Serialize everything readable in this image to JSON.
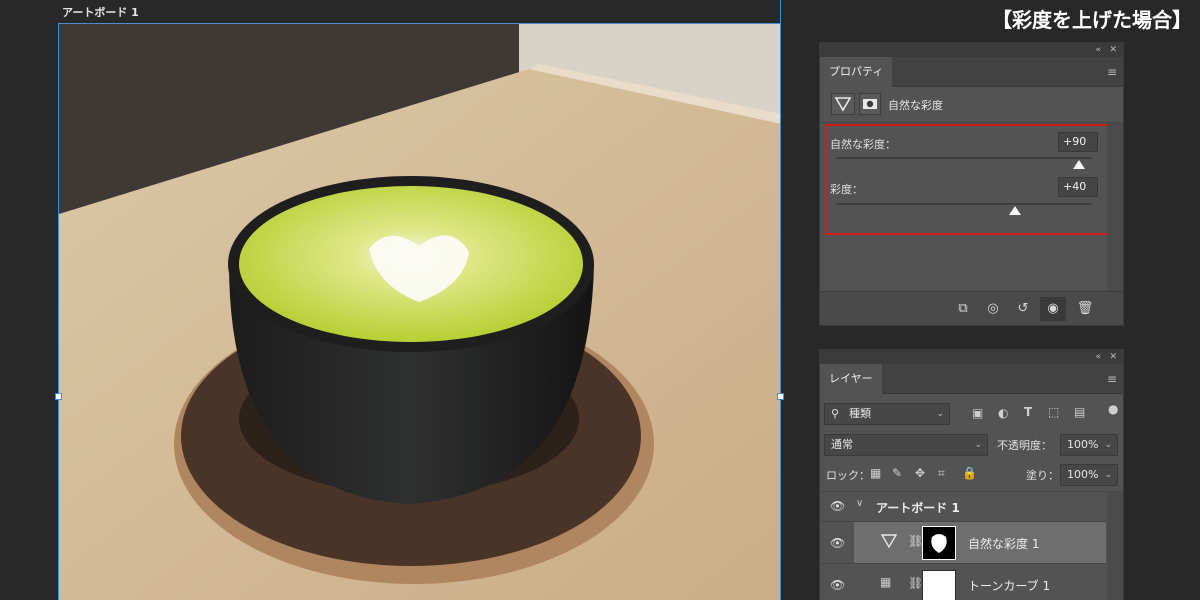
{
  "artboard": {
    "label": "アートボード 1"
  },
  "heading": "【彩度を上げた場合】",
  "properties_panel": {
    "tab": "プロパティ",
    "collapse_icon": "«",
    "close_icon": "✕",
    "menu_icon": "≡",
    "adjustment_title": "自然な彩度",
    "vibrance": {
      "label": "自然な彩度：",
      "value": "+90",
      "level": 0.95
    },
    "saturation": {
      "label": "彩度：",
      "value": "+40",
      "level": 0.7
    },
    "footer_icons": [
      "clip-to-layer-icon",
      "view-previous-icon",
      "reset-icon",
      "visibility-icon",
      "trash-icon"
    ]
  },
  "layers_panel": {
    "tab": "レイヤー",
    "collapse_icon": "«",
    "close_icon": "✕",
    "menu_icon": "≡",
    "filter": {
      "label": "種類"
    },
    "blend_mode": "通常",
    "opacity": {
      "label": "不透明度：",
      "value": "100%"
    },
    "lock": {
      "label": "ロック："
    },
    "fill": {
      "label": "塗り：",
      "value": "100%"
    },
    "layers": [
      {
        "name": "アートボード 1",
        "type": "artboard"
      },
      {
        "name": "自然な彩度 1",
        "type": "adjustment"
      },
      {
        "name": "トーンカーブ 1",
        "type": "adjustment"
      }
    ]
  }
}
